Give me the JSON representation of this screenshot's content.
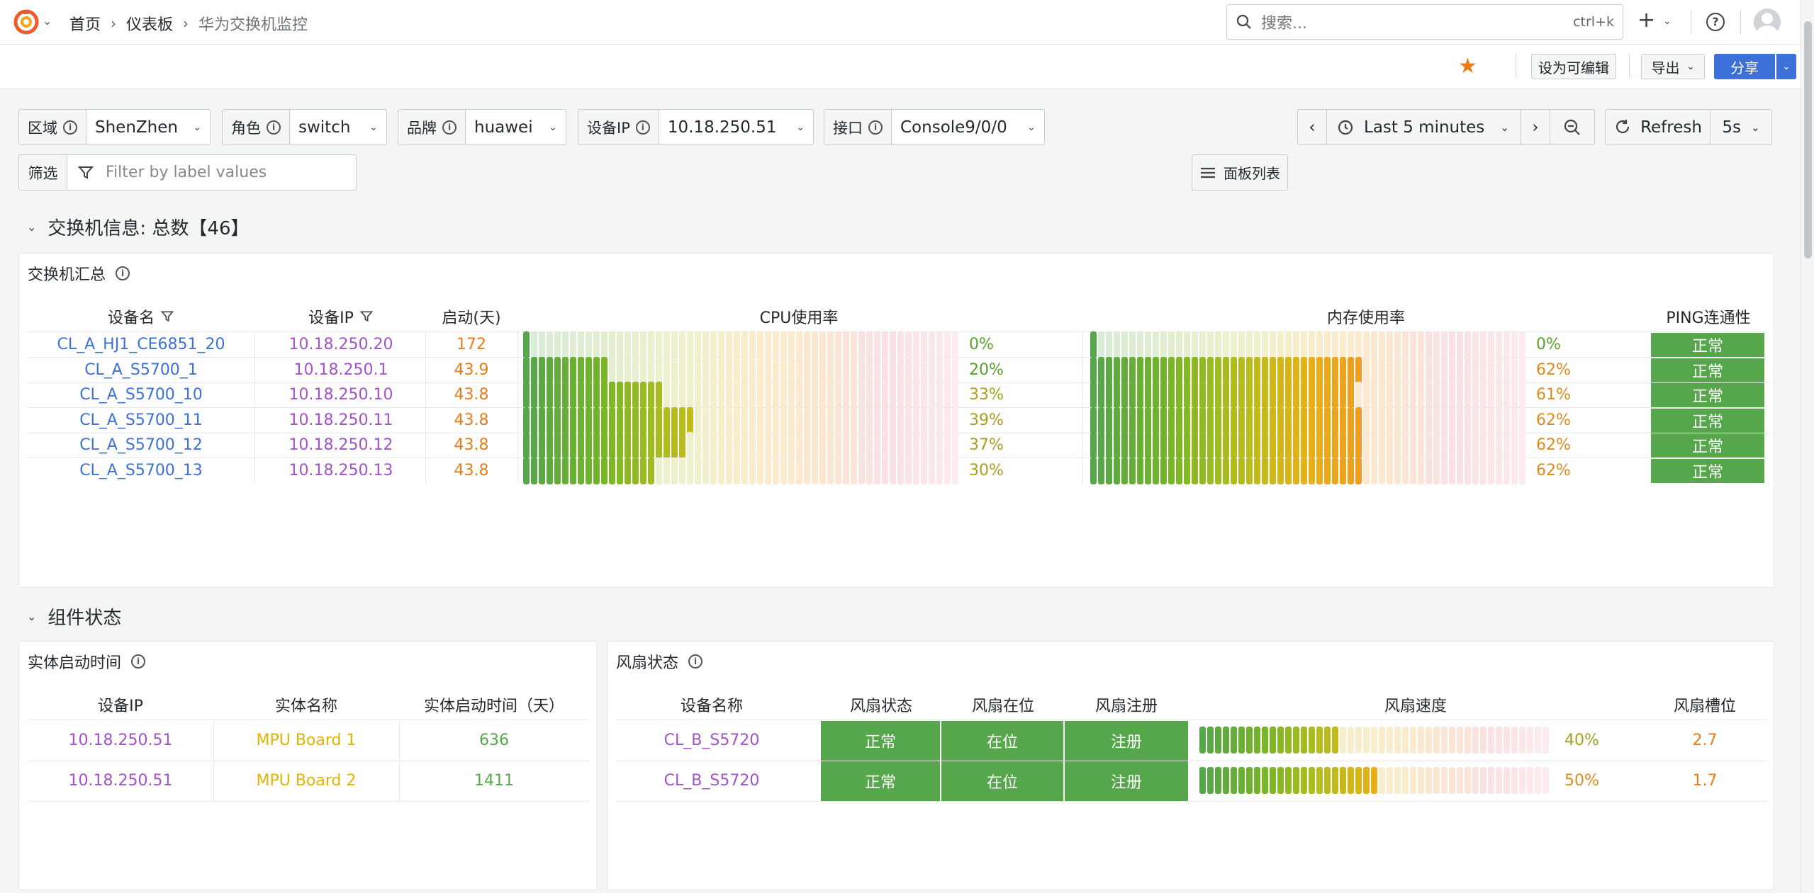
{
  "nav": {
    "breadcrumbs": [
      "首页",
      "仪表板",
      "华为交换机监控"
    ],
    "search_placeholder": "搜索...",
    "search_shortcut": "ctrl+k"
  },
  "toolbar": {
    "make_editable": "设为可编辑",
    "export": "导出",
    "share": "分享"
  },
  "variables": [
    {
      "label": "区域",
      "value": "ShenZhen"
    },
    {
      "label": "角色",
      "value": "switch"
    },
    {
      "label": "品牌",
      "value": "huawei"
    },
    {
      "label": "设备IP",
      "value": "10.18.250.51"
    },
    {
      "label": "接口",
      "value": "Console9/0/0"
    }
  ],
  "filter": {
    "label": "筛选",
    "placeholder": "Filter by label values"
  },
  "time": {
    "range": "Last 5 minutes",
    "refresh_label": "Refresh",
    "refresh_interval": "5s"
  },
  "panel_list": "面板列表",
  "colors": {
    "accent": "#3d71d9",
    "ok_green": "#56a64b",
    "link_blue": "#3d71d9",
    "purple": "#a352cc",
    "orange": "#eb7b18"
  },
  "sections": {
    "switch_info": {
      "title": "交换机信息: 总数【46】",
      "panel_title": "交换机汇总",
      "columns": [
        "设备名",
        "设备IP",
        "启动(天)",
        "CPU使用率",
        "内存使用率",
        "PING连通性"
      ],
      "rows": [
        {
          "name": "CL_A_HJ1_CE6851_20",
          "ip": "10.18.250.20",
          "uptime": "172",
          "cpu": 0,
          "cpu_label": "0%",
          "mem": 0,
          "mem_label": "0%",
          "ping": "正常"
        },
        {
          "name": "CL_A_S5700_1",
          "ip": "10.18.250.1",
          "uptime": "43.9",
          "cpu": 20,
          "cpu_label": "20%",
          "mem": 62,
          "mem_label": "62%",
          "ping": "正常"
        },
        {
          "name": "CL_A_S5700_10",
          "ip": "10.18.250.10",
          "uptime": "43.8",
          "cpu": 33,
          "cpu_label": "33%",
          "mem": 61,
          "mem_label": "61%",
          "ping": "正常"
        },
        {
          "name": "CL_A_S5700_11",
          "ip": "10.18.250.11",
          "uptime": "43.8",
          "cpu": 39,
          "cpu_label": "39%",
          "mem": 62,
          "mem_label": "62%",
          "ping": "正常"
        },
        {
          "name": "CL_A_S5700_12",
          "ip": "10.18.250.12",
          "uptime": "43.8",
          "cpu": 37,
          "cpu_label": "37%",
          "mem": 62,
          "mem_label": "62%",
          "ping": "正常"
        },
        {
          "name": "CL_A_S5700_13",
          "ip": "10.18.250.13",
          "uptime": "43.8",
          "cpu": 30,
          "cpu_label": "30%",
          "mem": 62,
          "mem_label": "62%",
          "ping": "正常"
        }
      ]
    },
    "component": {
      "title": "组件状态",
      "entity": {
        "panel_title": "实体启动时间",
        "columns": [
          "设备IP",
          "实体名称",
          "实体启动时间（天）"
        ],
        "rows": [
          {
            "ip": "10.18.250.51",
            "name": "MPU Board 1",
            "days": "636"
          },
          {
            "ip": "10.18.250.51",
            "name": "MPU Board 2",
            "days": "1411"
          }
        ]
      },
      "fan": {
        "panel_title": "风扇状态",
        "columns": [
          "设备名称",
          "风扇状态",
          "风扇在位",
          "风扇注册",
          "风扇速度",
          "风扇槽位"
        ],
        "rows": [
          {
            "name": "CL_B_S5720",
            "status": "正常",
            "present": "在位",
            "registered": "注册",
            "speed": 40,
            "speed_label": "40%",
            "slot": "2.7"
          },
          {
            "name": "CL_B_S5720",
            "status": "正常",
            "present": "在位",
            "registered": "注册",
            "speed": 50,
            "speed_label": "50%",
            "slot": "1.7"
          }
        ]
      }
    }
  }
}
